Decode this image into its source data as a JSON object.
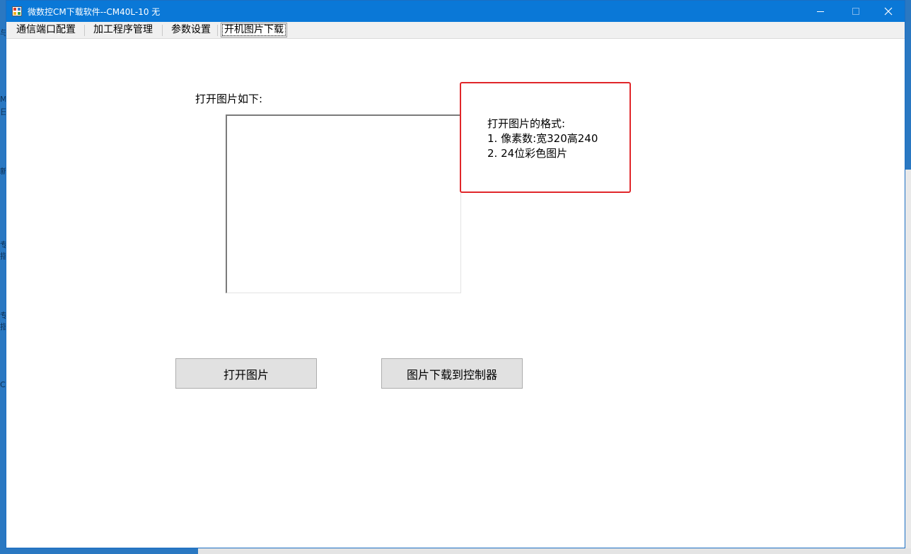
{
  "window": {
    "title": "微数控CM下载软件--CM40L-10   无",
    "controls": {
      "minimize_icon": "minimize-icon",
      "maximize_icon": "maximize-icon",
      "close_icon": "close-icon"
    }
  },
  "tabs": [
    {
      "label": "通信端口配置",
      "active": false
    },
    {
      "label": "加工程序管理",
      "active": false
    },
    {
      "label": "参数设置",
      "active": false
    },
    {
      "label": "开机图片下载",
      "active": true
    }
  ],
  "main": {
    "open_image_label": "打开图片如下:",
    "format_note": {
      "heading": "打开图片的格式:",
      "line1": "1. 像素数:宽320高240",
      "line2": "2. 24位彩色图片"
    },
    "buttons": {
      "open_image": "打开图片",
      "download_to_controller": "图片下载到控制器"
    }
  },
  "colors": {
    "titlebar": "#0a78d7",
    "note_border": "#e0262a",
    "button_face": "#e1e1e1"
  }
}
